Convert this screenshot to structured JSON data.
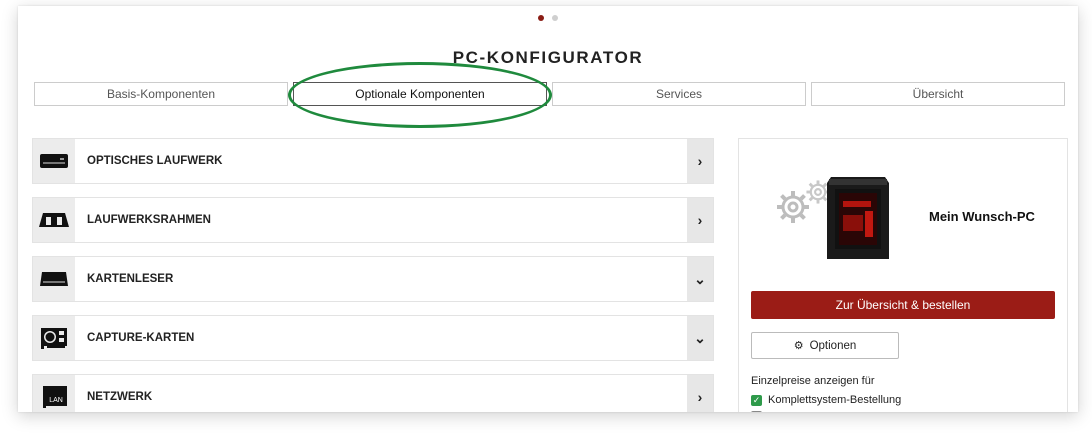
{
  "page": {
    "title": "PC-KONFIGURATOR"
  },
  "pager": {
    "active_index": 0,
    "count": 2
  },
  "tabs": [
    {
      "label": "Basis-Komponenten",
      "active": false
    },
    {
      "label": "Optionale Komponenten",
      "active": true
    },
    {
      "label": "Services",
      "active": false
    },
    {
      "label": "Übersicht",
      "active": false
    }
  ],
  "categories": [
    {
      "label": "OPTISCHES LAUFWERK",
      "icon": "optical-drive-icon",
      "chevron": "chevron-right-icon"
    },
    {
      "label": "LAUFWERKSRAHMEN",
      "icon": "drive-frame-icon",
      "chevron": "chevron-right-icon"
    },
    {
      "label": "KARTENLESER",
      "icon": "card-reader-icon",
      "chevron": "chevron-down-icon"
    },
    {
      "label": "CAPTURE-KARTEN",
      "icon": "capture-card-icon",
      "chevron": "chevron-down-icon"
    },
    {
      "label": "NETZWERK",
      "icon": "network-card-icon",
      "chevron": "chevron-right-icon",
      "icon_text": "LAN"
    }
  ],
  "summary": {
    "pc_name": "Mein Wunsch-PC",
    "order_button": "Zur Übersicht & bestellen",
    "options_button": "Optionen",
    "price_label": "Einzelpreise anzeigen für",
    "checkbox_label": "Komplettsystem-Bestellung"
  },
  "colors": {
    "accent": "#9b1c16",
    "highlight_oval": "#1f8a3d",
    "checkbox": "#2e9a4a"
  }
}
